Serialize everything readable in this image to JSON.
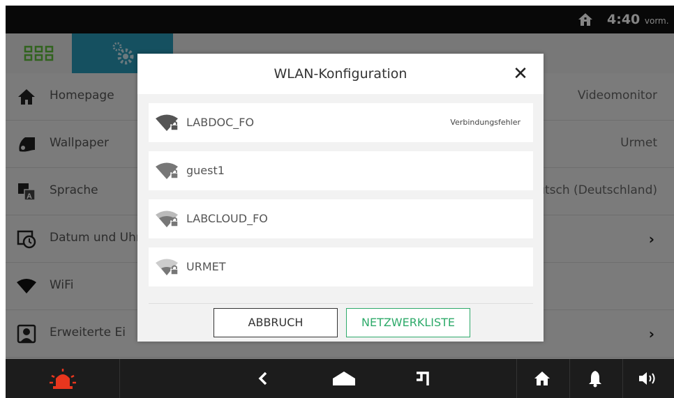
{
  "status_bar": {
    "time": "4:40",
    "period": "vorm."
  },
  "tabs": [
    {
      "icon": "apps-grid-icon"
    },
    {
      "icon": "settings-gears-icon"
    }
  ],
  "settings": {
    "rows": [
      {
        "label": "Homepage",
        "value": "Videomonitor"
      },
      {
        "label": "Wallpaper",
        "value": "Urmet"
      },
      {
        "label": "Sprache",
        "value": "utsch (Deutschland)"
      },
      {
        "label": "Datum und Uhrz",
        "value": ""
      },
      {
        "label": "WiFi",
        "value": ""
      },
      {
        "label": "Erweiterte Ei",
        "value": ""
      }
    ]
  },
  "dialog": {
    "title": "WLAN-Konfiguration",
    "close_label": "✕",
    "networks": [
      {
        "name": "LABDOC_FO",
        "status": "Verbindungsfehler",
        "locked": true
      },
      {
        "name": "guest1",
        "status": "",
        "locked": true
      },
      {
        "name": "LABCLOUD_FO",
        "status": "",
        "locked": true
      },
      {
        "name": "URMET",
        "status": "",
        "locked": true
      }
    ],
    "cancel_label": "ABBRUCH",
    "list_label": "NETZWERKLISTE"
  },
  "colors": {
    "accent_blue": "#2a9ab8",
    "accent_green": "#2eaa6a",
    "alarm_red": "#e8361e",
    "grid_green": "#5fbf3a"
  }
}
